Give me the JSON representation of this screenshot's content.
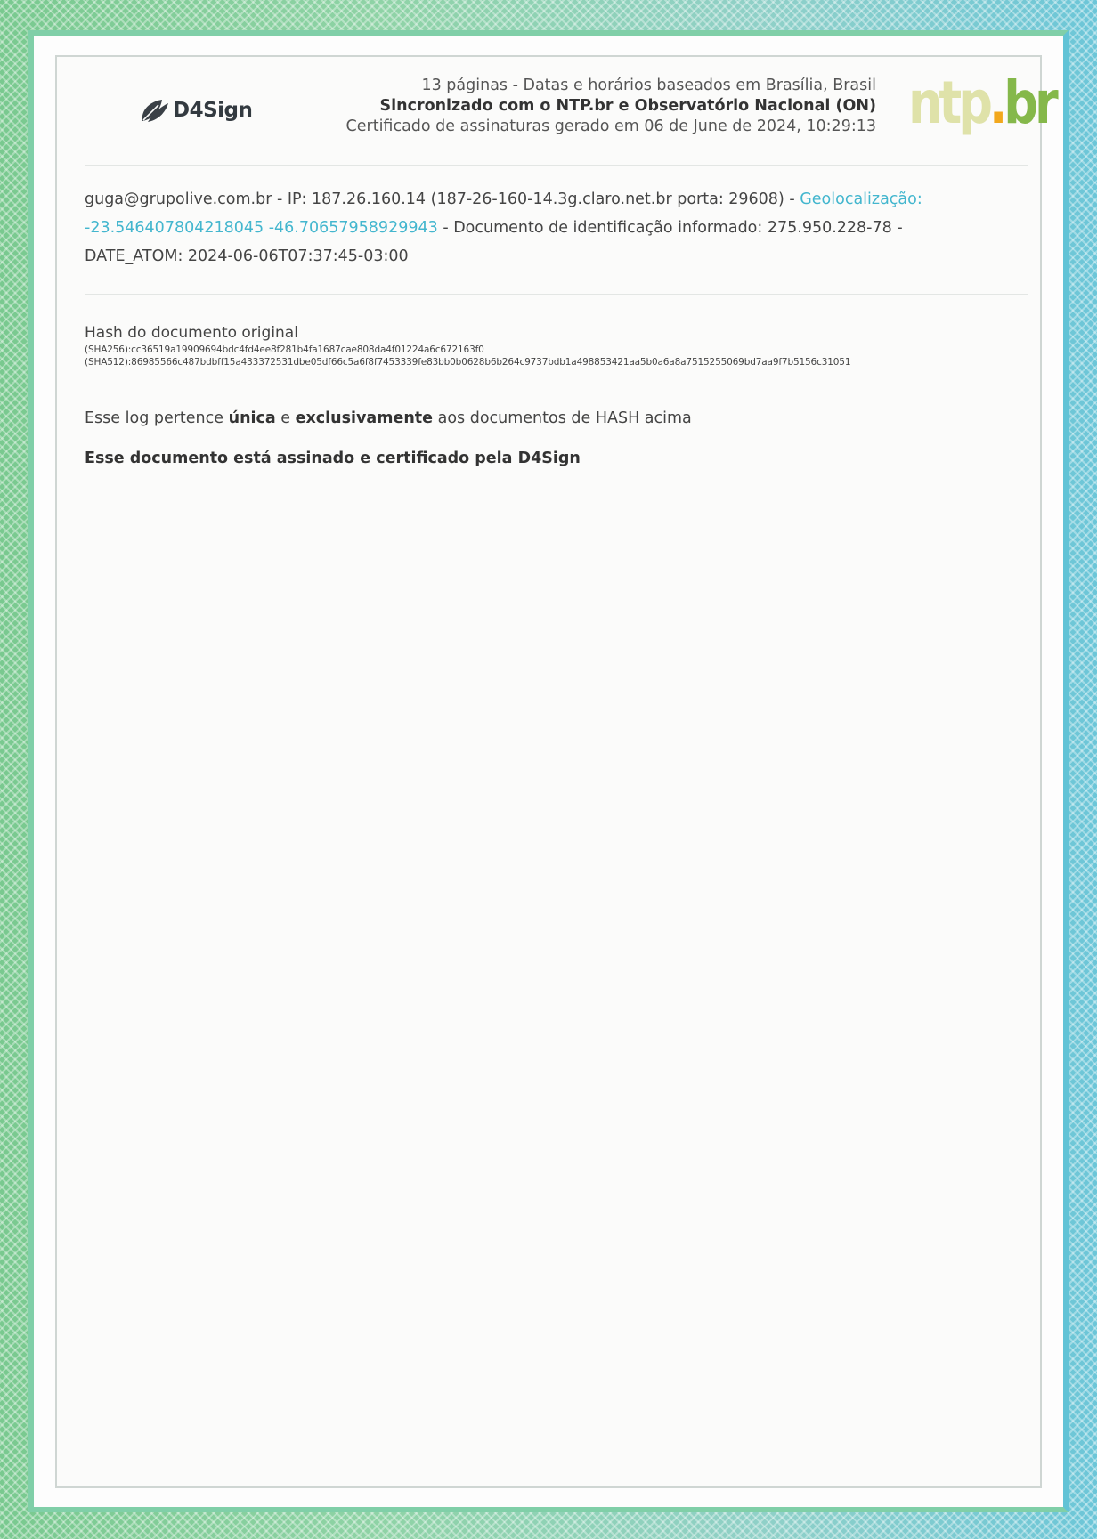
{
  "colors": {
    "frame_green": "#80cfa8",
    "frame_cyan": "#62c3d6",
    "geo_link": "#43b6ce",
    "ntp_text": "#dfe2a9",
    "ntp_dot": "#f2a81d",
    "ntp_br": "#85b84a"
  },
  "header": {
    "logo_left": {
      "text": "D4Sign",
      "icon": "leaf-icon"
    },
    "line1": "13 páginas - Datas e horários baseados em Brasília, Brasil",
    "line2": "Sincronizado com o NTP.br e Observatório Nacional (ON)",
    "line3": "Certificado de assinaturas gerado em 06 de June de 2024, 10:29:13",
    "logo_right": {
      "ntp": "ntp",
      "dot": ".",
      "br": "br"
    }
  },
  "signer": {
    "email": "guga@grupolive.com.br",
    "ip_text": " - IP: 187.26.160.14 (187-26-160-14.3g.claro.net.br porta: 29608) - ",
    "geo_label": "Geolocalização:",
    "geo_coords": "-23.546407804218045 -46.70657958929943",
    "doc_text": " - Documento de identificação informado: 275.950.228-78 -",
    "date_atom": "DATE_ATOM: 2024-06-06T07:37:45-03:00"
  },
  "hash": {
    "title": "Hash do documento original",
    "sha256": "(SHA256):cc36519a19909694bdc4fd4ee8f281b4fa1687cae808da4f01224a6c672163f0",
    "sha512": "(SHA512):86985566c487bdbff15a433372531dbe05df66c5a6f8f7453339fe83bb0b0628b6b264c9737bdb1a498853421aa5b0a6a8a7515255069bd7aa9f7b5156c31051"
  },
  "log_note": {
    "part1": "Esse log pertence ",
    "bold1": "única",
    "part2": " e ",
    "bold2": "exclusivamente",
    "part3": " aos documentos de HASH acima"
  },
  "signed_note": "Esse documento está assinado e certificado pela D4Sign"
}
